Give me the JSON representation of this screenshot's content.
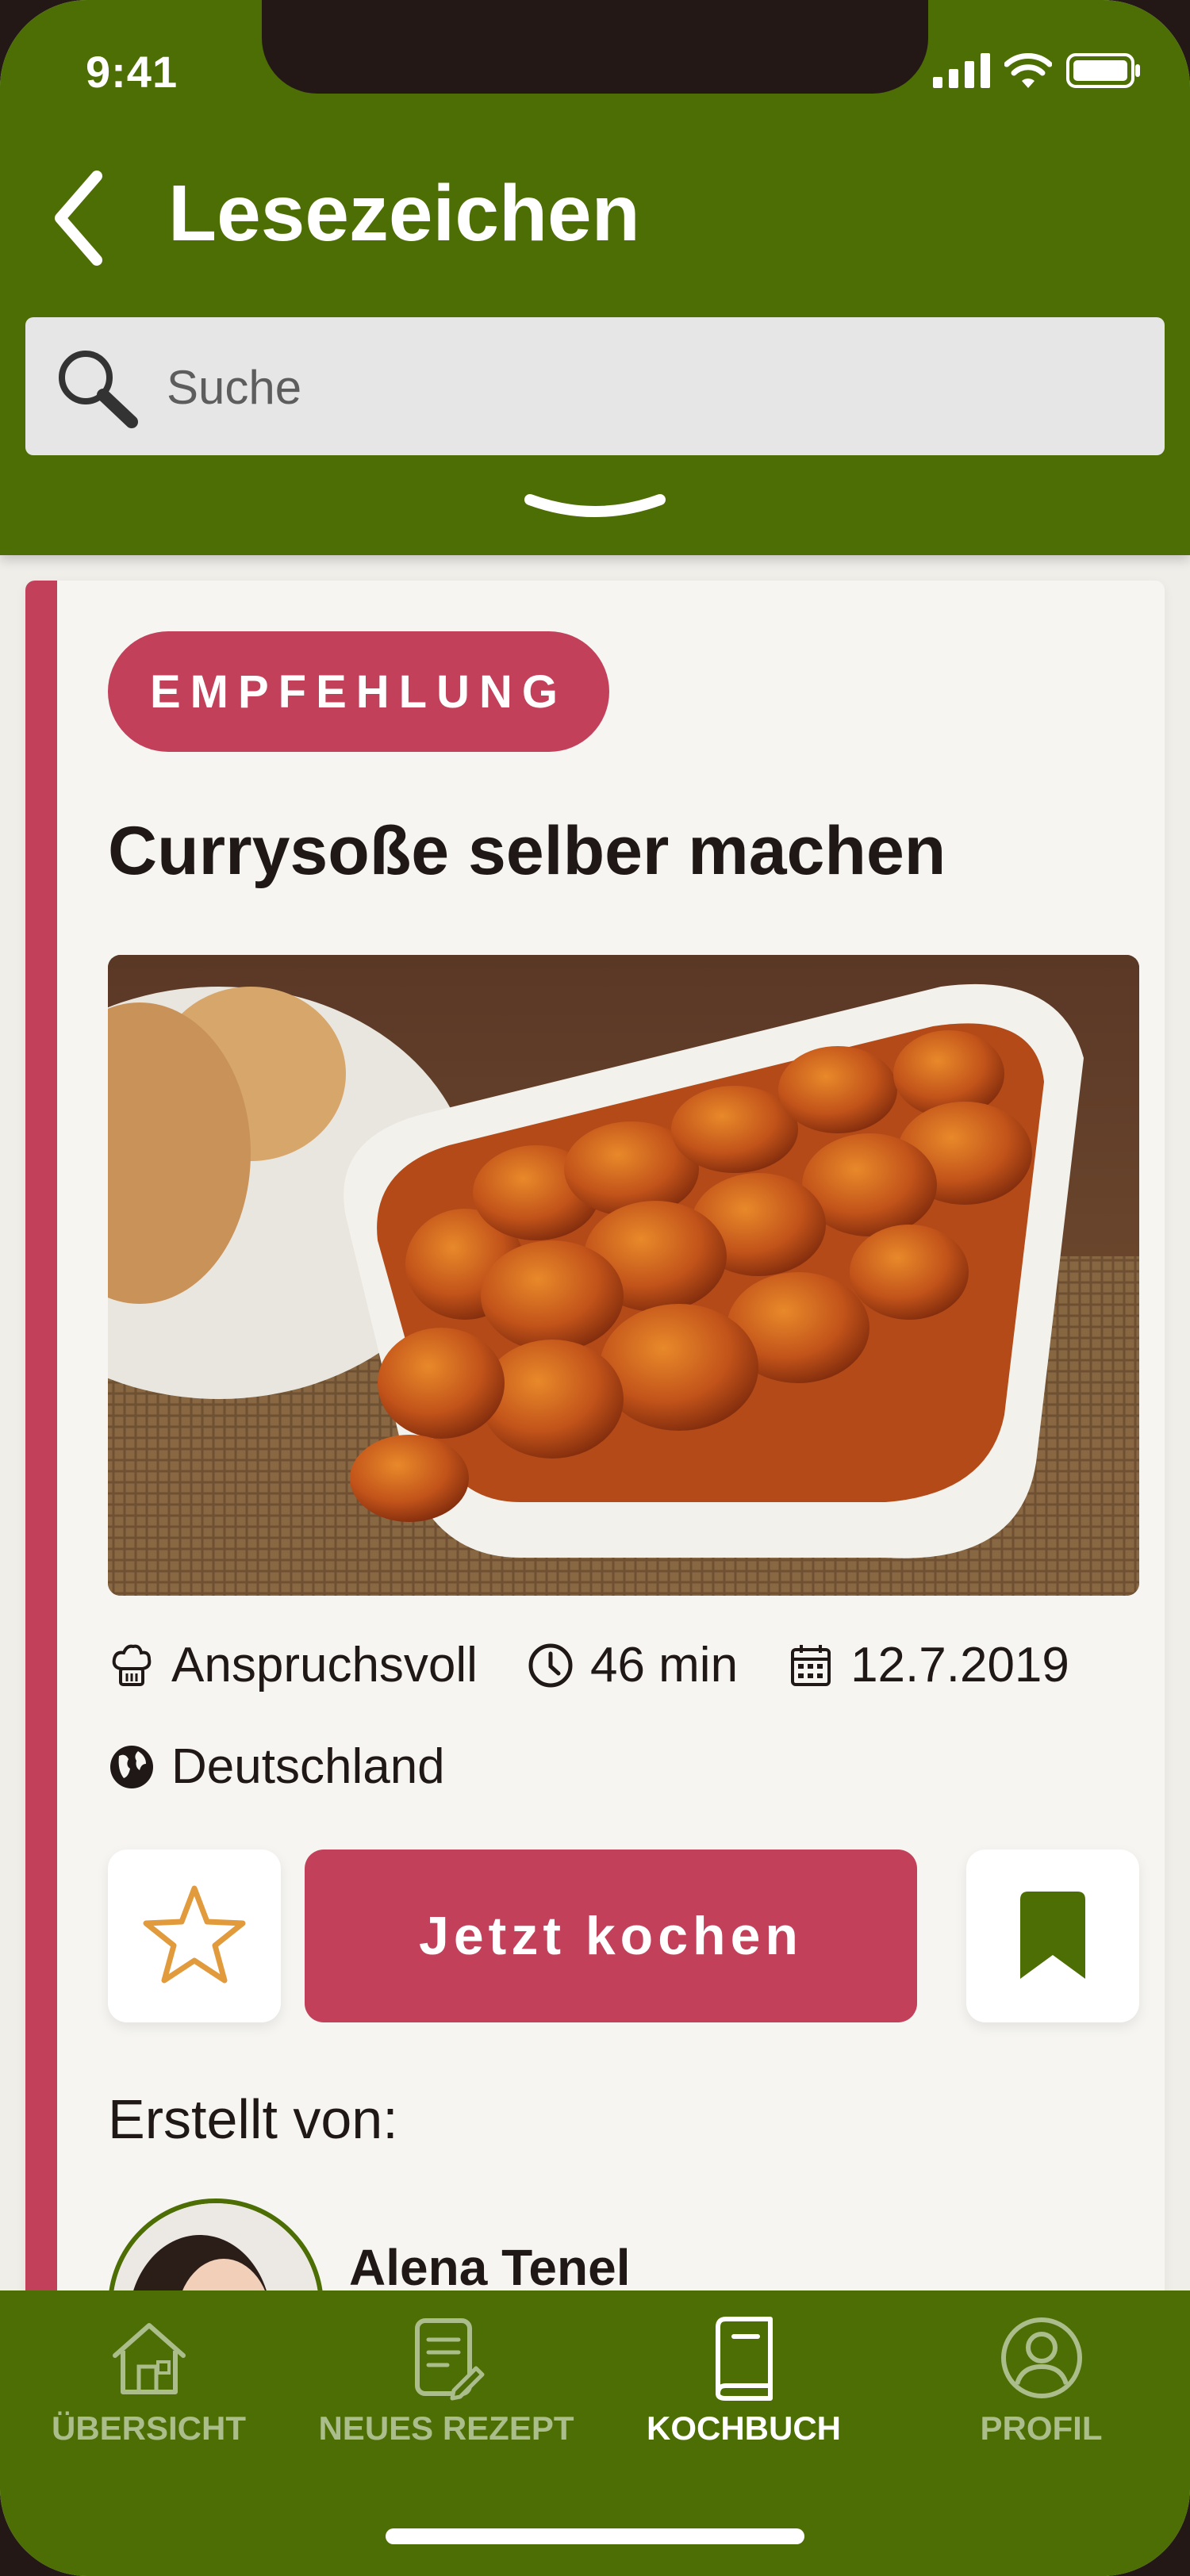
{
  "status_bar": {
    "time": "9:41"
  },
  "header": {
    "title": "Lesezeichen"
  },
  "search": {
    "placeholder": "Suche"
  },
  "recipe": {
    "badge": "EMPFEHLUNG",
    "title": "Currysoße selber machen",
    "difficulty": "Anspruchsvoll",
    "duration": "46 min",
    "date": "12.7.2019",
    "country": "Deutschland",
    "cook_button": "Jetzt kochen",
    "created_by_label": "Erstellt von:",
    "author": "Alena Tenel"
  },
  "tabs": [
    {
      "label": "ÜBERSICHT",
      "icon": "house-icon",
      "active": false
    },
    {
      "label": "NEUES REZEPT",
      "icon": "document-edit-icon",
      "active": false
    },
    {
      "label": "KOCHBUCH",
      "icon": "book-icon",
      "active": true
    },
    {
      "label": "PROFIL",
      "icon": "user-circle-icon",
      "active": false
    }
  ],
  "colors": {
    "brand_green": "#4c6e04",
    "accent_red": "#c2405a",
    "star_orange": "#e19a3c",
    "card_bg": "#f6f5f1"
  }
}
